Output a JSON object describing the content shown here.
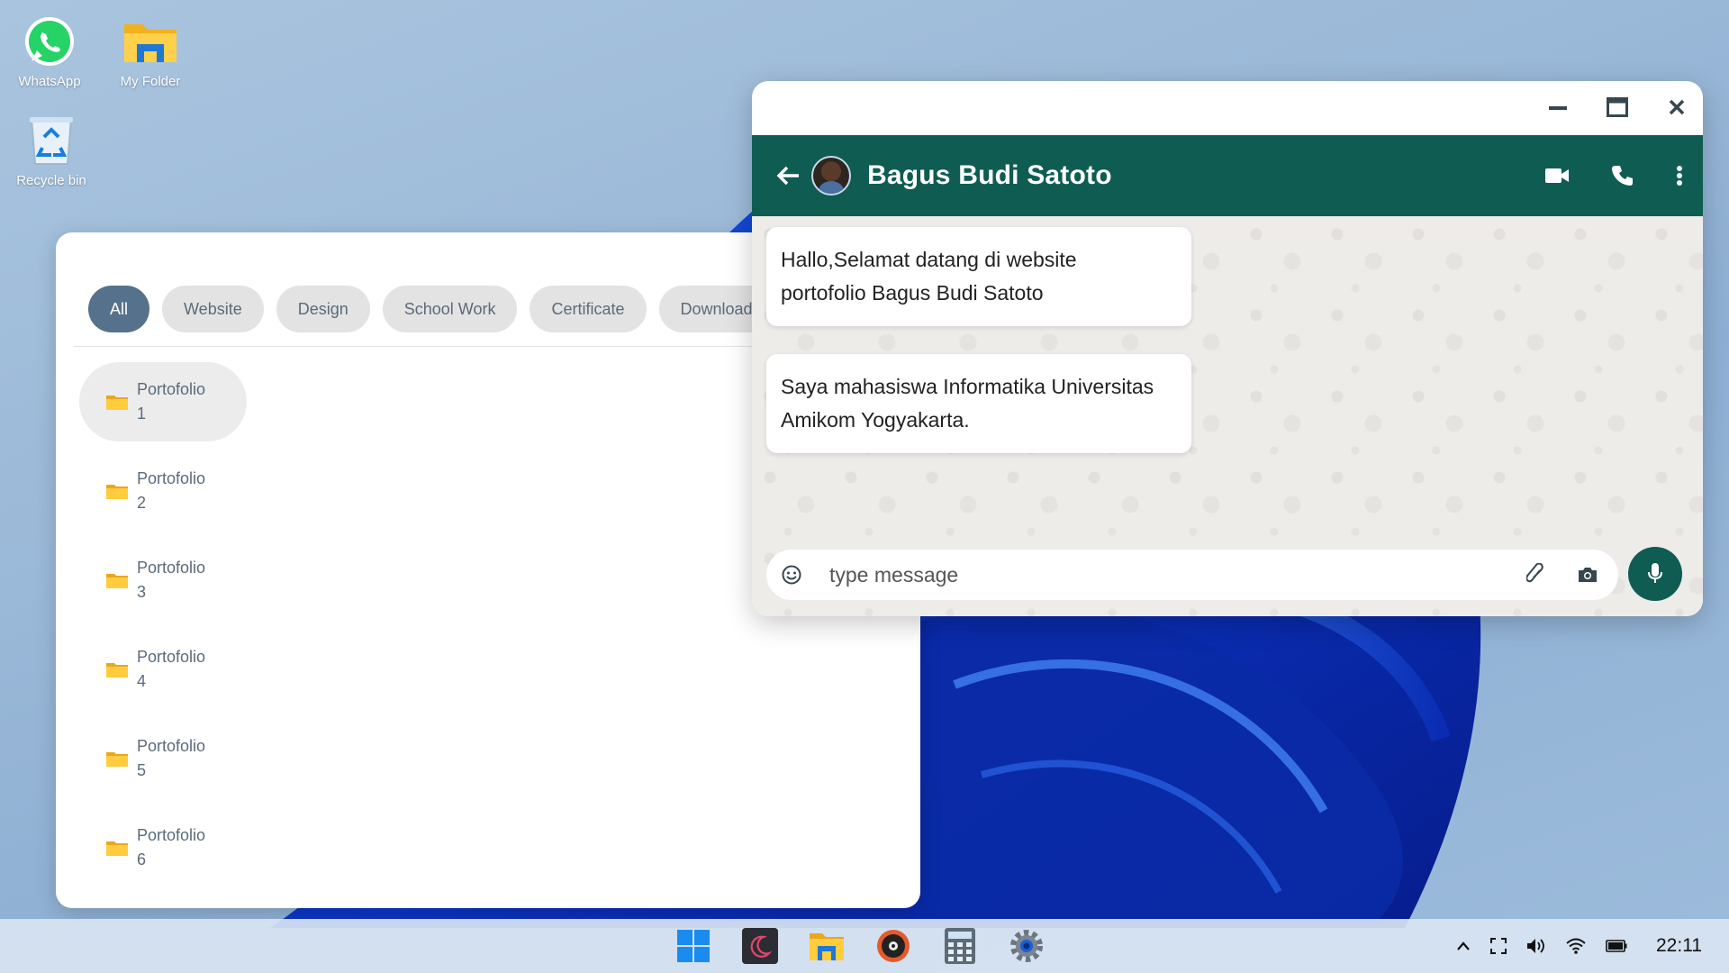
{
  "desktop": {
    "icons": [
      {
        "label": "WhatsApp",
        "icon": "whatsapp-icon"
      },
      {
        "label": "My Folder",
        "icon": "folder-icon"
      },
      {
        "label": "Recycle bin",
        "icon": "recycle-bin-icon"
      }
    ]
  },
  "portfolio_window": {
    "tabs": [
      {
        "label": "All",
        "active": true
      },
      {
        "label": "Website",
        "active": false
      },
      {
        "label": "Design",
        "active": false
      },
      {
        "label": "School Work",
        "active": false
      },
      {
        "label": "Certificate",
        "active": false
      },
      {
        "label": "Download",
        "active": false
      }
    ],
    "folders": [
      {
        "line1": "Portofolio",
        "line2": "1",
        "selected": true
      },
      {
        "line1": "Portofolio",
        "line2": "2",
        "selected": false
      },
      {
        "line1": "Portofolio",
        "line2": "3",
        "selected": false
      },
      {
        "line1": "Portofolio",
        "line2": "4",
        "selected": false
      },
      {
        "line1": "Portofolio",
        "line2": "5",
        "selected": false
      },
      {
        "line1": "Portofolio",
        "line2": "6",
        "selected": false
      }
    ]
  },
  "chat_window": {
    "contact_name": "Bagus Budi Satoto",
    "messages": [
      {
        "line1": "Hallo,Selamat datang di website",
        "line2": "portofolio Bagus Budi Satoto"
      },
      {
        "line1": "Saya mahasiswa Informatika Universitas",
        "line2": "Amikom Yogyakarta."
      }
    ],
    "composer_placeholder": "type message",
    "colors": {
      "header": "#0f5c53",
      "mic": "#0f5c53"
    }
  },
  "taskbar": {
    "apps": [
      "windows-start-icon",
      "moon-app-icon",
      "file-explorer-icon",
      "music-player-icon",
      "calculator-icon",
      "settings-icon"
    ],
    "tray": [
      "chevron-up-icon",
      "fullscreen-icon",
      "volume-icon",
      "wifi-icon",
      "battery-icon"
    ],
    "clock": "22:11"
  }
}
